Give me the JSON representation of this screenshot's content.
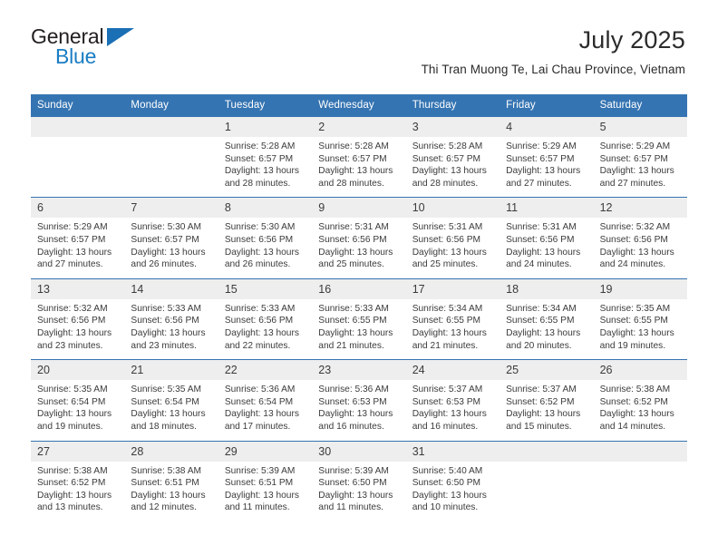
{
  "brand": {
    "name_top": "General",
    "name_bottom": "Blue",
    "accent_color": "#1a6fb5"
  },
  "header": {
    "title": "July 2025",
    "subtitle": "Thi Tran Muong Te, Lai Chau Province, Vietnam"
  },
  "colors": {
    "header_blue": "#3574b2",
    "daynum_band": "#eeeeee",
    "text": "#3b3b3b"
  },
  "weekdays": [
    "Sunday",
    "Monday",
    "Tuesday",
    "Wednesday",
    "Thursday",
    "Friday",
    "Saturday"
  ],
  "weeks": [
    [
      {
        "day": "",
        "lines": []
      },
      {
        "day": "",
        "lines": []
      },
      {
        "day": "1",
        "lines": [
          "Sunrise: 5:28 AM",
          "Sunset: 6:57 PM",
          "Daylight: 13 hours",
          "and 28 minutes."
        ]
      },
      {
        "day": "2",
        "lines": [
          "Sunrise: 5:28 AM",
          "Sunset: 6:57 PM",
          "Daylight: 13 hours",
          "and 28 minutes."
        ]
      },
      {
        "day": "3",
        "lines": [
          "Sunrise: 5:28 AM",
          "Sunset: 6:57 PM",
          "Daylight: 13 hours",
          "and 28 minutes."
        ]
      },
      {
        "day": "4",
        "lines": [
          "Sunrise: 5:29 AM",
          "Sunset: 6:57 PM",
          "Daylight: 13 hours",
          "and 27 minutes."
        ]
      },
      {
        "day": "5",
        "lines": [
          "Sunrise: 5:29 AM",
          "Sunset: 6:57 PM",
          "Daylight: 13 hours",
          "and 27 minutes."
        ]
      }
    ],
    [
      {
        "day": "6",
        "lines": [
          "Sunrise: 5:29 AM",
          "Sunset: 6:57 PM",
          "Daylight: 13 hours",
          "and 27 minutes."
        ]
      },
      {
        "day": "7",
        "lines": [
          "Sunrise: 5:30 AM",
          "Sunset: 6:57 PM",
          "Daylight: 13 hours",
          "and 26 minutes."
        ]
      },
      {
        "day": "8",
        "lines": [
          "Sunrise: 5:30 AM",
          "Sunset: 6:56 PM",
          "Daylight: 13 hours",
          "and 26 minutes."
        ]
      },
      {
        "day": "9",
        "lines": [
          "Sunrise: 5:31 AM",
          "Sunset: 6:56 PM",
          "Daylight: 13 hours",
          "and 25 minutes."
        ]
      },
      {
        "day": "10",
        "lines": [
          "Sunrise: 5:31 AM",
          "Sunset: 6:56 PM",
          "Daylight: 13 hours",
          "and 25 minutes."
        ]
      },
      {
        "day": "11",
        "lines": [
          "Sunrise: 5:31 AM",
          "Sunset: 6:56 PM",
          "Daylight: 13 hours",
          "and 24 minutes."
        ]
      },
      {
        "day": "12",
        "lines": [
          "Sunrise: 5:32 AM",
          "Sunset: 6:56 PM",
          "Daylight: 13 hours",
          "and 24 minutes."
        ]
      }
    ],
    [
      {
        "day": "13",
        "lines": [
          "Sunrise: 5:32 AM",
          "Sunset: 6:56 PM",
          "Daylight: 13 hours",
          "and 23 minutes."
        ]
      },
      {
        "day": "14",
        "lines": [
          "Sunrise: 5:33 AM",
          "Sunset: 6:56 PM",
          "Daylight: 13 hours",
          "and 23 minutes."
        ]
      },
      {
        "day": "15",
        "lines": [
          "Sunrise: 5:33 AM",
          "Sunset: 6:56 PM",
          "Daylight: 13 hours",
          "and 22 minutes."
        ]
      },
      {
        "day": "16",
        "lines": [
          "Sunrise: 5:33 AM",
          "Sunset: 6:55 PM",
          "Daylight: 13 hours",
          "and 21 minutes."
        ]
      },
      {
        "day": "17",
        "lines": [
          "Sunrise: 5:34 AM",
          "Sunset: 6:55 PM",
          "Daylight: 13 hours",
          "and 21 minutes."
        ]
      },
      {
        "day": "18",
        "lines": [
          "Sunrise: 5:34 AM",
          "Sunset: 6:55 PM",
          "Daylight: 13 hours",
          "and 20 minutes."
        ]
      },
      {
        "day": "19",
        "lines": [
          "Sunrise: 5:35 AM",
          "Sunset: 6:55 PM",
          "Daylight: 13 hours",
          "and 19 minutes."
        ]
      }
    ],
    [
      {
        "day": "20",
        "lines": [
          "Sunrise: 5:35 AM",
          "Sunset: 6:54 PM",
          "Daylight: 13 hours",
          "and 19 minutes."
        ]
      },
      {
        "day": "21",
        "lines": [
          "Sunrise: 5:35 AM",
          "Sunset: 6:54 PM",
          "Daylight: 13 hours",
          "and 18 minutes."
        ]
      },
      {
        "day": "22",
        "lines": [
          "Sunrise: 5:36 AM",
          "Sunset: 6:54 PM",
          "Daylight: 13 hours",
          "and 17 minutes."
        ]
      },
      {
        "day": "23",
        "lines": [
          "Sunrise: 5:36 AM",
          "Sunset: 6:53 PM",
          "Daylight: 13 hours",
          "and 16 minutes."
        ]
      },
      {
        "day": "24",
        "lines": [
          "Sunrise: 5:37 AM",
          "Sunset: 6:53 PM",
          "Daylight: 13 hours",
          "and 16 minutes."
        ]
      },
      {
        "day": "25",
        "lines": [
          "Sunrise: 5:37 AM",
          "Sunset: 6:52 PM",
          "Daylight: 13 hours",
          "and 15 minutes."
        ]
      },
      {
        "day": "26",
        "lines": [
          "Sunrise: 5:38 AM",
          "Sunset: 6:52 PM",
          "Daylight: 13 hours",
          "and 14 minutes."
        ]
      }
    ],
    [
      {
        "day": "27",
        "lines": [
          "Sunrise: 5:38 AM",
          "Sunset: 6:52 PM",
          "Daylight: 13 hours",
          "and 13 minutes."
        ]
      },
      {
        "day": "28",
        "lines": [
          "Sunrise: 5:38 AM",
          "Sunset: 6:51 PM",
          "Daylight: 13 hours",
          "and 12 minutes."
        ]
      },
      {
        "day": "29",
        "lines": [
          "Sunrise: 5:39 AM",
          "Sunset: 6:51 PM",
          "Daylight: 13 hours",
          "and 11 minutes."
        ]
      },
      {
        "day": "30",
        "lines": [
          "Sunrise: 5:39 AM",
          "Sunset: 6:50 PM",
          "Daylight: 13 hours",
          "and 11 minutes."
        ]
      },
      {
        "day": "31",
        "lines": [
          "Sunrise: 5:40 AM",
          "Sunset: 6:50 PM",
          "Daylight: 13 hours",
          "and 10 minutes."
        ]
      },
      {
        "day": "",
        "lines": []
      },
      {
        "day": "",
        "lines": []
      }
    ]
  ]
}
